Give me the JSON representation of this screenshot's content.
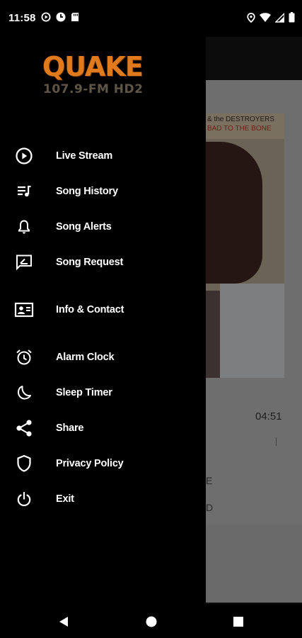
{
  "status_bar": {
    "time": "11:58",
    "left_icons": [
      "play-circle-icon",
      "app-icon",
      "sd-card-icon"
    ],
    "right_icons": [
      "location-icon",
      "wifi-icon",
      "signal-icon",
      "battery-icon"
    ]
  },
  "drawer": {
    "logo_title": "QUAKE",
    "logo_subtitle": "107.9-FM HD2",
    "items": [
      {
        "label": "Live Stream",
        "icon": "play-circle-icon"
      },
      {
        "label": "Song History",
        "icon": "playlist-icon"
      },
      {
        "label": "Song Alerts",
        "icon": "bell-icon"
      },
      {
        "label": "Song Request",
        "icon": "request-icon"
      },
      {
        "label": "Info & Contact",
        "icon": "contact-card-icon"
      },
      {
        "label": "Alarm Clock",
        "icon": "alarm-clock-icon"
      },
      {
        "label": "Sleep Timer",
        "icon": "moon-icon"
      },
      {
        "label": "Share",
        "icon": "share-icon"
      },
      {
        "label": "Privacy Policy",
        "icon": "shield-icon"
      },
      {
        "label": "Exit",
        "icon": "power-icon"
      }
    ]
  },
  "background": {
    "album_text_line1": "& the DESTROYERS",
    "album_text_line2": "BAD TO THE BONE",
    "duration": "04:51",
    "fragment1": "E",
    "fragment2": "D"
  },
  "colors": {
    "logo_orange": "#e07a1c",
    "drawer_bg": "#000000",
    "scrim": "#6e6e6e"
  }
}
